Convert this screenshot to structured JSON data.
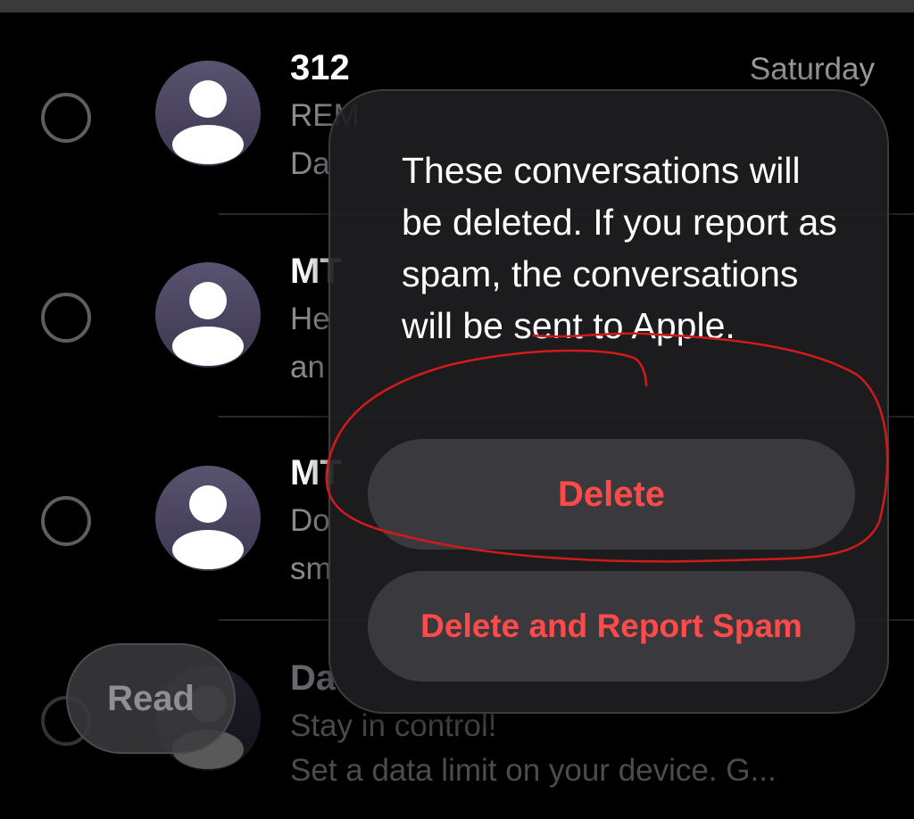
{
  "conversations": [
    {
      "sender": "312",
      "preview_line1": "REM",
      "preview_line2": "Da",
      "date": "Saturday"
    },
    {
      "sender": "MT",
      "preview_line1": "He",
      "preview_line2": "an"
    },
    {
      "sender": "MT",
      "preview_line1": "Do",
      "preview_line2": "sm"
    },
    {
      "sender": "Da",
      "preview_line1": "Stay in control!",
      "preview_line2": "Set a data limit on your device. G..."
    }
  ],
  "toolbar": {
    "read_label": "Read"
  },
  "alert": {
    "message": "These conversations will be deleted. If you report as spam, the conversations will be sent to Apple.",
    "delete_label": "Delete",
    "delete_and_report_label": "Delete and Report Spam",
    "destructive_color": "#FF4A4A"
  },
  "annotation": {
    "color": "#D11A1A"
  }
}
